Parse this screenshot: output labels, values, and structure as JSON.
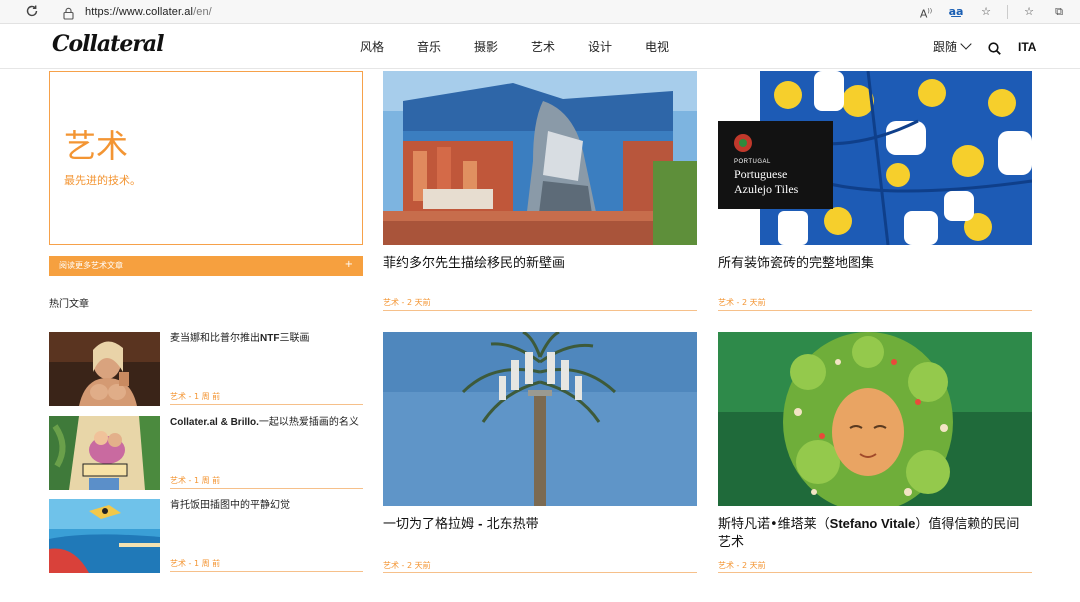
{
  "browser": {
    "url_host": "https://www.collater.al",
    "url_path": "/en/"
  },
  "header": {
    "logo": "Collateral",
    "nav": [
      "风格",
      "音乐",
      "摄影",
      "艺术",
      "设计",
      "电视"
    ],
    "follow_label": "跟随",
    "lang_label": "ITA"
  },
  "section": {
    "title": "艺术",
    "subtitle": "最先进的技术。",
    "read_more": "阅读更多艺术文章",
    "read_more_plus": "+"
  },
  "popular": {
    "title": "热门文章",
    "items": [
      {
        "title_pre": "麦当娜和比普尔推出",
        "title_bold": "NTF",
        "title_post": "三联画",
        "meta": "艺术 - 1 周 前"
      },
      {
        "title_pre": "",
        "title_bold": "Collater.al & Brillo.",
        "title_post": "一起以热爱插画的名义",
        "meta": "艺术 - 1 周 前"
      },
      {
        "title_pre": "肯托饭田插图中的平静幻觉",
        "title_bold": "",
        "title_post": "",
        "meta": "艺术 - 1 周 前"
      }
    ]
  },
  "cards": [
    {
      "title_pre": "菲约多尔先生描绘移民的新壁画",
      "title_bold": "",
      "title_post": "",
      "meta": "艺术 - 2 天前"
    },
    {
      "title_pre": "所有装饰瓷砖的完整地图集",
      "title_bold": "",
      "title_post": "",
      "meta": "艺术 - 2 天前",
      "overlay": {
        "flag_label": "PORTUGAL",
        "line1": "Portuguese",
        "line2": "Azulejo Tiles"
      }
    },
    {
      "title_pre": "一切为了格拉姆 ",
      "title_bold": "-",
      "title_post": " 北东热带",
      "meta": "艺术 - 2 天前"
    },
    {
      "title_pre": "斯特凡诺•维塔莱（",
      "title_bold": "Stefano Vitale",
      "title_post": "）值得信赖的民间艺术",
      "meta": "艺术 - 2 天前"
    }
  ],
  "colors": {
    "accent": "#f39533",
    "accent_bg": "#f6a03f",
    "border": "#f6a14a"
  },
  "icons": [
    "reload-icon",
    "lock-icon",
    "read-aloud-icon",
    "translate-icon",
    "favorite-icon",
    "favorites-bar-icon",
    "collections-icon",
    "search-icon",
    "chevron-down-icon"
  ]
}
